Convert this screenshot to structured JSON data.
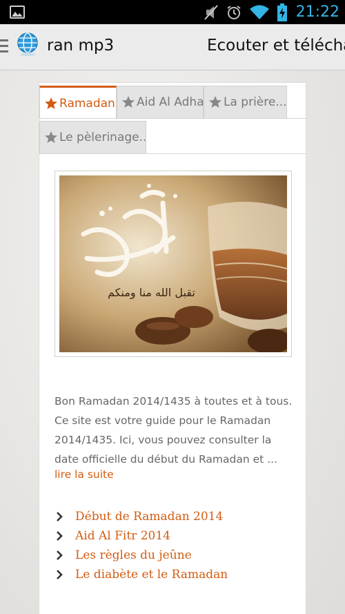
{
  "status_bar": {
    "time": "21:22",
    "icons": [
      "gallery-icon",
      "mute-icon",
      "alarm-icon",
      "wifi-icon",
      "battery-charging-icon"
    ]
  },
  "action_bar": {
    "app_title": "ran mp3",
    "page_title": "Ecouter et télécha",
    "icons": [
      "menu-icon",
      "globe-icon"
    ]
  },
  "tabs": [
    {
      "label": "Ramadan",
      "active": true
    },
    {
      "label": "Aid Al Adha",
      "active": false
    },
    {
      "label": "La prière...",
      "active": false
    },
    {
      "label": "Le pèlerinage...",
      "active": false
    }
  ],
  "article": {
    "image_caption_arabic": "تقبل الله منا ومنكم",
    "description": "Bon Ramadan 2014/1435 à toutes et à tous. Ce site est votre guide pour le Ramadan 2014/1435. Ici, vous pouvez consulter la date officielle du début du Ramadan et ...",
    "read_more": "lire la suite",
    "links": [
      "Début de Ramadan 2014",
      "Aid Al Fitr 2014",
      "Les règles du jeûne",
      "Le diabète et le Ramadan"
    ]
  },
  "colors": {
    "accent": "#d25c12",
    "status_time": "#33b5e5",
    "tab_inactive": "#e4e4e4"
  }
}
